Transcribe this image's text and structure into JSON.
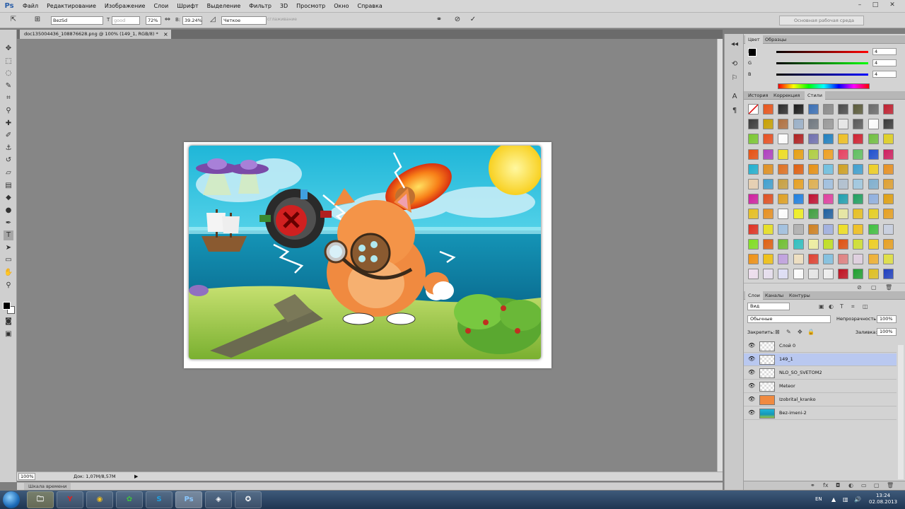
{
  "app": {
    "logo": "Ps",
    "menu": [
      "Файл",
      "Редактирование",
      "Изображение",
      "Слои",
      "Шрифт",
      "Выделение",
      "Фильтр",
      "3D",
      "Просмотр",
      "Окно",
      "Справка"
    ],
    "workspace": "Основная рабочая среда",
    "window_controls": [
      "–",
      "□",
      "✕"
    ]
  },
  "options_bar": {
    "style_field": "BezSd",
    "good_field": "good",
    "zoom_field": "72%",
    "b_label": "В:",
    "b_field": "39.24%",
    "mode_field": "Четкое",
    "mode_hint": "сглаживание",
    "cancel_icon": "⊘",
    "commit_icon": "✓"
  },
  "document": {
    "tab_title": "doc135004436_108876628.png @ 100% (149_1, RGB/8) *",
    "tab_close": "×"
  },
  "status": {
    "zoom": "100%",
    "doc_size": "Док: 1,07M/8,57M"
  },
  "timeline": {
    "tab": "Шкала времени"
  },
  "color_panel": {
    "tabs": [
      "Цвет",
      "Образцы"
    ],
    "sliders": [
      {
        "label": "R",
        "value": "4"
      },
      {
        "label": "G",
        "value": "4"
      },
      {
        "label": "B",
        "value": "4"
      }
    ]
  },
  "styles_panel": {
    "tabs": [
      "История",
      "Коррекция",
      "Стили"
    ],
    "active_tab": "Стили",
    "swatch_colors": [
      "#ffffff",
      "#e8541a",
      "#2a2a2a",
      "#1a1a1a",
      "#3a6fb5",
      "#8a8a8a",
      "#4a4a4a",
      "#5a5a3a",
      "#6a6a6a",
      "#c02030",
      "#3a3a3a",
      "#c8a000",
      "#b07040",
      "#9ab0c8",
      "#707880",
      "#9a9a9a",
      "#e8e8e8",
      "#5a5a5a",
      "#ffffff",
      "#3a3a3a",
      "#7ac830",
      "#e85020",
      "#ffffff",
      "#b02020",
      "#7070b0",
      "#2080c0",
      "#f0c020",
      "#d02030",
      "#70c040",
      "#e0d020",
      "#e85010",
      "#b040c0",
      "#f0e020",
      "#e8a010",
      "#b0d040",
      "#f0a020",
      "#e84060",
      "#60c060",
      "#2050d0",
      "#d02060",
      "#20b0d0",
      "#e09020",
      "#e07020",
      "#e06010",
      "#e89010",
      "#70c0e0",
      "#d0a020",
      "#40a0d0",
      "#f0d020",
      "#e89020",
      "#e8d0b0",
      "#40a0d0",
      "#c8a040",
      "#e8a020",
      "#e0b050",
      "#a0c0e0",
      "#b0c0d0",
      "#a0c8e0",
      "#80b0d0",
      "#e0a030",
      "#d020a0",
      "#e05020",
      "#e0a020",
      "#2080e0",
      "#c01030",
      "#e040a0",
      "#20a0b0",
      "#20a060",
      "#90b0e0",
      "#e0a010",
      "#e8c020",
      "#e89020",
      "#ffffff",
      "#f0f020",
      "#40a040",
      "#2060a0",
      "#e8e8a0",
      "#e8c020",
      "#e8d020",
      "#e8a020",
      "#e03020",
      "#e8e020",
      "#a0c0e0",
      "#b0b0b0",
      "#d08020",
      "#a0b0e0",
      "#f0e020",
      "#f0c020",
      "#40c040",
      "#c8d0e0",
      "#80e020",
      "#e06010",
      "#70c030",
      "#30c0c0",
      "#f0f0a0",
      "#c0e020",
      "#e05010",
      "#d0e030",
      "#f0d020",
      "#e8a020",
      "#f09010",
      "#f0c010",
      "#c0a0e0",
      "#f0e0c0",
      "#e04030",
      "#80c0e0",
      "#e08080",
      "#e0d0e0",
      "#f0b030",
      "#e0e040",
      "#f0e0f0",
      "#e8e0f0",
      "#e0e0f8",
      "#ffffff",
      "#e8e8e8",
      "#f0f0f0",
      "#c01020",
      "#20a030",
      "#e0c020",
      "#2040c0"
    ]
  },
  "layers_panel": {
    "tabs": [
      "Слои",
      "Каналы",
      "Контуры"
    ],
    "filter": "Вид",
    "blend_mode": "Обычные",
    "opacity_label": "Непрозрачность:",
    "opacity_value": "100%",
    "lock_label": "Закрепить:",
    "fill_label": "Заливка:",
    "fill_value": "100%",
    "layers": [
      {
        "name": "Слой 0",
        "selected": false
      },
      {
        "name": "149_1",
        "selected": true
      },
      {
        "name": "NLO_SO_SVETOM2",
        "selected": false
      },
      {
        "name": "Meteor",
        "selected": false
      },
      {
        "name": "Izobrital_kranko",
        "selected": false
      },
      {
        "name": "Bez-imeni-2",
        "selected": false
      }
    ]
  },
  "taskbar": {
    "ps_label": "Ps",
    "lang": "EN",
    "time": "13:24",
    "date": "02.08.2013"
  }
}
